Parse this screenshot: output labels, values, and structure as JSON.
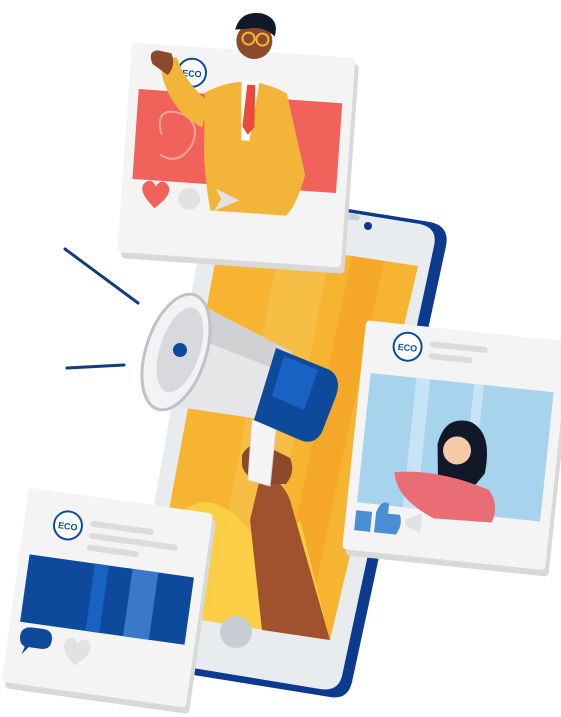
{
  "illustration": {
    "subject": "social-media-marketing",
    "brand_badge_text": "ECO",
    "colors": {
      "phone_frame": "#0b3a8f",
      "phone_body": "#e9ecef",
      "screen_yellow": "#f6b431",
      "screen_orange": "#f49b1f",
      "card_bg": "#f4f4f4",
      "card_shadow": "#d9d9d9",
      "coral": "#f0625a",
      "man_jacket": "#f2b53a",
      "man_tie": "#e84a3b",
      "skin_dark": "#8b4a2b",
      "skin_light": "#f6c9a8",
      "woman_top": "#ea6c74",
      "sky_blue": "#a7d3ec",
      "banner_blue": "#0d4a9c",
      "megaphone_grey": "#e6e7e8",
      "megaphone_blue": "#0d4a9c",
      "line_navy": "#143b7a"
    }
  }
}
